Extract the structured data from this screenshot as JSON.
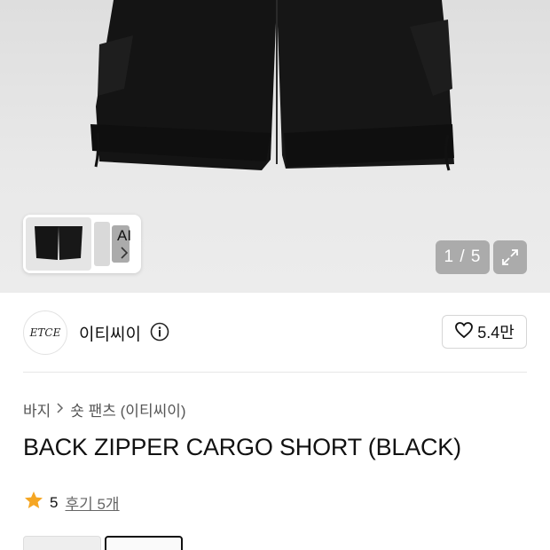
{
  "gallery": {
    "counter": "1 / 5",
    "ai_label": "AI",
    "icons": {
      "expand": "expand-icon",
      "chevron": "chevron-right-icon"
    }
  },
  "brand": {
    "logo_text": "ETCE",
    "name": "이티씨이",
    "likes": "5.4만",
    "icons": {
      "info": "info-icon",
      "heart": "heart-icon"
    }
  },
  "breadcrumb": {
    "category": "바지",
    "subcategory": "숏 팬츠 (이티씨이)"
  },
  "product": {
    "title": "BACK ZIPPER CARGO SHORT (BLACK)"
  },
  "rating": {
    "score": "5",
    "reviews": "후기 5개",
    "star_color": "#f5a623"
  }
}
